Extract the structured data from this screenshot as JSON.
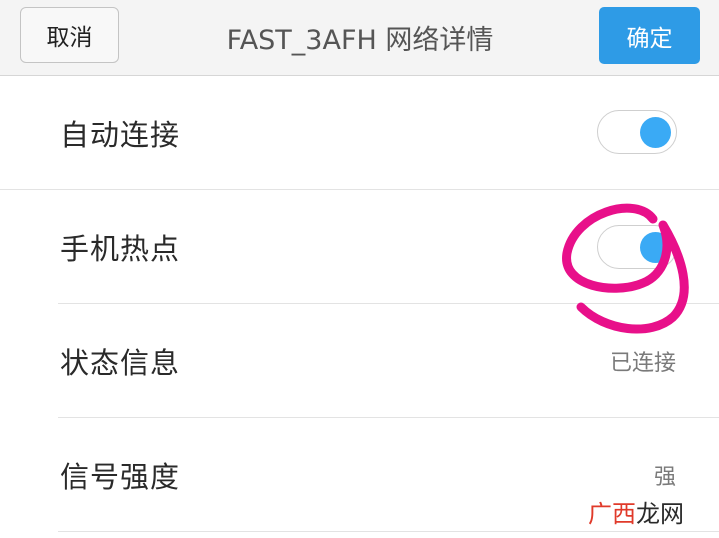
{
  "header": {
    "cancel_label": "取消",
    "title": "FAST_3AFH  网络详情",
    "confirm_label": "确定"
  },
  "rows": [
    {
      "label": "自动连接",
      "control": "toggle",
      "on": true
    },
    {
      "label": "手机热点",
      "control": "toggle",
      "on": true
    },
    {
      "label": "状态信息",
      "value": "已连接"
    },
    {
      "label": "信号强度",
      "value": "强"
    }
  ],
  "watermark": {
    "text": "广西龙网"
  },
  "colors": {
    "accent": "#2e9be6",
    "toggle_knob": "#3aaaf5",
    "annotation": "#e8108a",
    "watermark_red": "#e03a2a"
  }
}
